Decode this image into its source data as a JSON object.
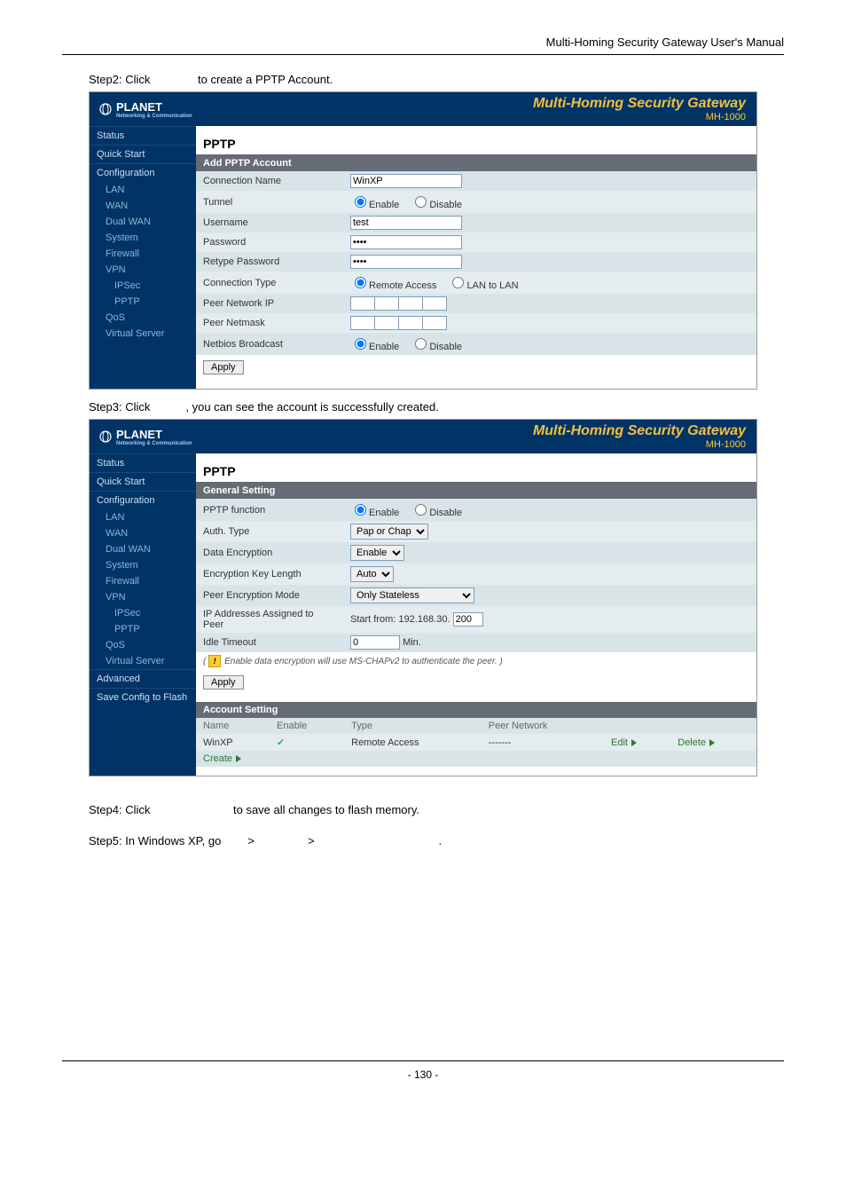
{
  "doc_header": "Multi-Homing Security Gateway User's Manual",
  "step2": "Step2: Click",
  "step2_after": " to create a PPTP Account.",
  "step3": "Step3: Click",
  "step3_after": ", you can see the account is successfully created.",
  "step4": "Step4: Click",
  "step4_after": " to save all changes to flash memory.",
  "step5_a": "Step5: In Windows XP, go",
  "step5_arrow": ">",
  "step5_period": ".",
  "page_num": "- 130 -",
  "brand": "PLANET",
  "brand_sub": "Networking & Communication",
  "product_title": "Multi-Homing Security Gateway",
  "product_model": "MH-1000",
  "sidebar1": [
    "Status",
    "Quick Start",
    "Configuration",
    "LAN",
    "WAN",
    "Dual WAN",
    "System",
    "Firewall",
    "VPN",
    "IPSec",
    "PPTP",
    "QoS",
    "Virtual Server"
  ],
  "sidebar1_sub_idx": {
    "LAN": 3,
    "WAN": 3,
    "Dual WAN": 3,
    "System": 3,
    "Firewall": 3,
    "VPN": 3,
    "IPSec": 9,
    "PPTP": 9,
    "QoS": 3,
    "Virtual Server": 3
  },
  "panel1": {
    "title": "PPTP",
    "section": "Add PPTP Account",
    "rows": {
      "conn_name_label": "Connection Name",
      "conn_name_value": "WinXP",
      "tunnel_label": "Tunnel",
      "tunnel_enable": "Enable",
      "tunnel_disable": "Disable",
      "user_label": "Username",
      "user_value": "test",
      "pass_label": "Password",
      "pass_value": "••••",
      "repass_label": "Retype Password",
      "repass_value": "••••",
      "ct_label": "Connection Type",
      "ct_remote": "Remote Access",
      "ct_lan": "LAN to LAN",
      "pni_label": "Peer Network IP",
      "pnm_label": "Peer Netmask",
      "nb_label": "Netbios Broadcast",
      "nb_enable": "Enable",
      "nb_disable": "Disable"
    },
    "apply": "Apply"
  },
  "sidebar2": [
    "Status",
    "Quick Start",
    "Configuration",
    "LAN",
    "WAN",
    "Dual WAN",
    "System",
    "Firewall",
    "VPN",
    "IPSec",
    "PPTP",
    "QoS",
    "Virtual Server",
    "Advanced",
    "Save Config to Flash"
  ],
  "panel2": {
    "title": "PPTP",
    "section1": "General Setting",
    "rows": {
      "func_label": "PPTP function",
      "func_enable": "Enable",
      "func_disable": "Disable",
      "auth_label": "Auth. Type",
      "auth_value": "Pap or Chap",
      "de_label": "Data Encryption",
      "de_value": "Enable",
      "ekl_label": "Encryption Key Length",
      "ekl_value": "Auto",
      "pem_label": "Peer Encryption Mode",
      "pem_value": "Only Stateless",
      "ipa_label": "IP Addresses Assigned to Peer",
      "ipa_prefix": "Start from: 192.168.30.",
      "ipa_value": "200",
      "idle_label": "Idle Timeout",
      "idle_value": "0",
      "idle_unit": "Min."
    },
    "note": "Enable data encryption will use MS-CHAPv2 to authenticate the peer.",
    "apply": "Apply",
    "section2": "Account Setting",
    "cols": {
      "name": "Name",
      "enable": "Enable",
      "type": "Type",
      "peer": "Peer Network"
    },
    "row": {
      "name": "WinXP",
      "type": "Remote Access",
      "peer": "-------",
      "edit": "Edit",
      "delete": "Delete"
    },
    "create": "Create"
  }
}
